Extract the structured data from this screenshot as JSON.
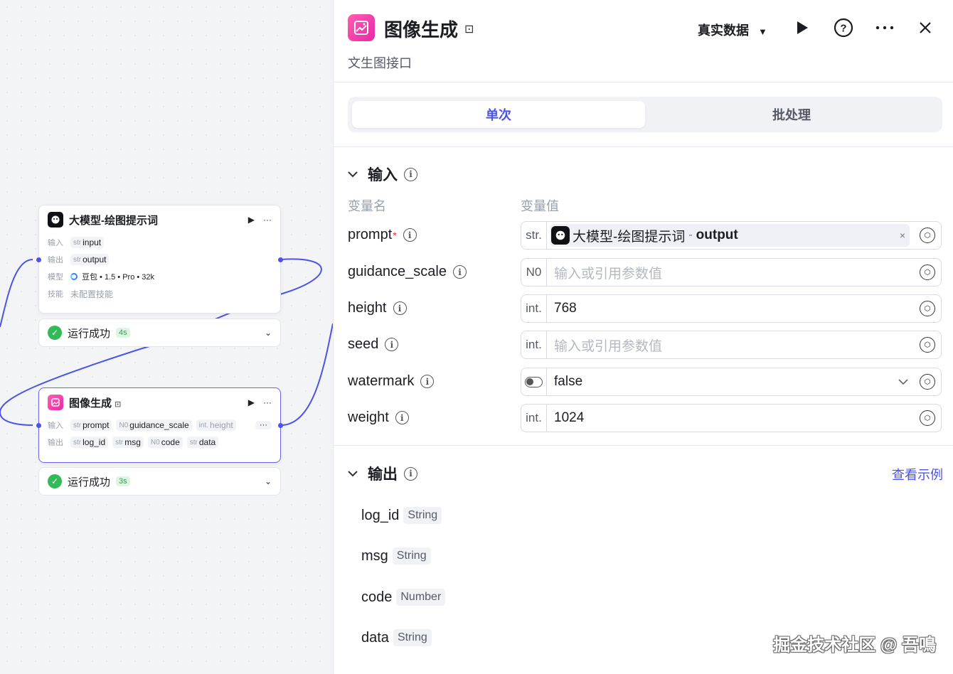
{
  "canvas": {
    "node1": {
      "title": "大模型-绘图提示词",
      "run_icon": "▶",
      "more_icon": "···",
      "input_label": "输入",
      "input": {
        "type": "str",
        "name": "input"
      },
      "output_label": "输出",
      "output": {
        "type": "str",
        "name": "output"
      },
      "model_label": "模型",
      "model": "豆包 • 1.5 • Pro • 32k",
      "skill_label": "技能",
      "skill": "未配置技能",
      "status": "运行成功",
      "duration": "4s"
    },
    "node2": {
      "title": "图像生成",
      "run_icon": "▶",
      "more_icon": "···",
      "input_label": "输入",
      "inputs": [
        {
          "type": "str",
          "name": "prompt"
        },
        {
          "type": "N0",
          "name": "guidance_scale"
        },
        {
          "type": "int.",
          "name": "height"
        }
      ],
      "inputs_more": "···",
      "output_label": "输出",
      "outputs": [
        {
          "type": "str",
          "name": "log_id"
        },
        {
          "type": "str",
          "name": "msg"
        },
        {
          "type": "N0",
          "name": "code"
        },
        {
          "type": "str",
          "name": "data"
        }
      ],
      "status": "运行成功",
      "duration": "3s"
    }
  },
  "panel": {
    "title": "图像生成",
    "subtitle": "文生图接口",
    "mode": "真实数据",
    "mode_caret": "▼",
    "tabs": [
      {
        "label": "单次",
        "active": true
      },
      {
        "label": "批处理",
        "active": false
      }
    ],
    "input_section": {
      "title": "输入",
      "col_name": "变量名",
      "col_value": "变量值",
      "params": [
        {
          "name": "prompt",
          "required": "*",
          "type": "str.",
          "ref_node": "大模型-绘图提示词",
          "ref_sep": "-",
          "ref_field": "output",
          "remove": "×"
        },
        {
          "name": "guidance_scale",
          "type": "N0",
          "placeholder": "输入或引用参数值"
        },
        {
          "name": "height",
          "type": "int.",
          "value": "768"
        },
        {
          "name": "seed",
          "type": "int.",
          "placeholder": "输入或引用参数值"
        },
        {
          "name": "watermark",
          "type": "toggle",
          "value": "false"
        },
        {
          "name": "weight",
          "type": "int.",
          "value": "1024"
        }
      ]
    },
    "output_section": {
      "title": "输出",
      "example_link": "查看示例",
      "fields": [
        {
          "name": "log_id",
          "type": "String"
        },
        {
          "name": "msg",
          "type": "String"
        },
        {
          "name": "code",
          "type": "Number"
        },
        {
          "name": "data",
          "type": "String"
        }
      ]
    }
  },
  "watermark": "掘金技术社区 @ 吾鳴",
  "colors": {
    "accent": "#4d53e8",
    "success": "#32b95a",
    "node_pink": "#e829a6",
    "edge": "#4d53e8"
  }
}
